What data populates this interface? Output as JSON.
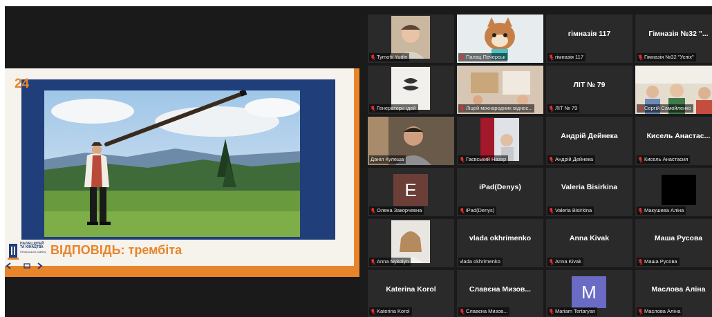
{
  "slide": {
    "number": "24",
    "answer": "ВІДПОВІДЬ:  трембіта",
    "logo_title": "ПАЛАЦ ДІТЕЙ ТА ЮНАЦТВА",
    "logo_sub": "Печерського району"
  },
  "colors": {
    "slide_orange": "#e8852a",
    "slide_blue": "#1f3e7a",
    "active_speaker": "#c9e04a",
    "muted_mic": "#e0322f",
    "tile_bg": "#2a2a2a"
  },
  "participants": [
    {
      "label": "Tymofii Yudin",
      "muted": true,
      "kind": "video"
    },
    {
      "label": "Палац Печерськ",
      "muted": true,
      "kind": "video"
    },
    {
      "label": "гімназія 117",
      "center": "гімназія 117",
      "muted": true,
      "kind": "name"
    },
    {
      "label": "Гімназія №32 \"Успіх\"",
      "center": "Гімназія №32 \"...",
      "muted": true,
      "kind": "name"
    },
    {
      "label": "Генератори ідей",
      "muted": true,
      "kind": "video"
    },
    {
      "label": "Ліцей міжнародних віднос...",
      "muted": true,
      "kind": "video"
    },
    {
      "label": "ЛІТ № 79",
      "center": "ЛІТ № 79",
      "muted": true,
      "kind": "name"
    },
    {
      "label": "Сергій Самойленко",
      "muted": true,
      "kind": "video"
    },
    {
      "label": "Даніл Кулеша",
      "muted": false,
      "kind": "video",
      "active": true
    },
    {
      "label": "Гаєвський Назар",
      "muted": true,
      "kind": "video"
    },
    {
      "label": "Андрій Дейнека",
      "center": "Андрій Дейнека",
      "muted": true,
      "kind": "name"
    },
    {
      "label": "Кисель Анастасия",
      "center": "Кисель  Анастас...",
      "muted": true,
      "kind": "name"
    },
    {
      "label": "Олена Закорчевна",
      "avatar": "E",
      "avatar_color": "#6b3f38",
      "muted": true,
      "kind": "avatar"
    },
    {
      "label": "iPad(Denys)",
      "center": "iPad(Denys)",
      "muted": true,
      "kind": "name"
    },
    {
      "label": "Valeria Bisirkina",
      "center": "Valeria Bisirkina",
      "muted": true,
      "kind": "name"
    },
    {
      "label": "Макушева Аліна",
      "muted": true,
      "kind": "black"
    },
    {
      "label": "Anna Nykolyn",
      "muted": true,
      "kind": "video"
    },
    {
      "label": "vlada okhrimenko",
      "center": "vlada okhrimenko",
      "muted": false,
      "kind": "name"
    },
    {
      "label": "Anna Kivak",
      "center": "Anna Kivak",
      "muted": true,
      "kind": "name"
    },
    {
      "label": "Маша Русова",
      "center": "Маша Русова",
      "muted": true,
      "kind": "name"
    },
    {
      "label": "Katerina Korol",
      "center": "Katerina Korol",
      "muted": true,
      "kind": "name"
    },
    {
      "label": "Славєна Мизов...",
      "center": "Славєна  Мизов...",
      "muted": true,
      "kind": "name"
    },
    {
      "label": "Mariam Tertaryan",
      "avatar": "M",
      "avatar_color": "#6a6bc4",
      "muted": true,
      "kind": "avatar"
    },
    {
      "label": "Маслова Аліна",
      "center": "Маслова Аліна",
      "muted": true,
      "kind": "name"
    }
  ]
}
